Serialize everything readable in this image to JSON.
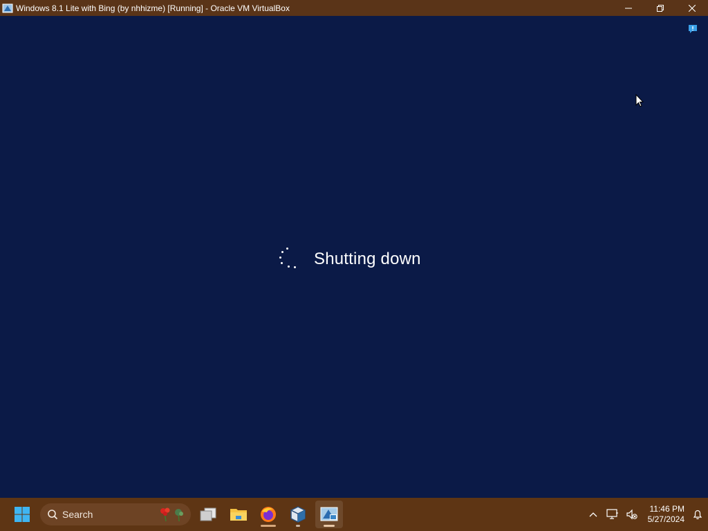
{
  "window": {
    "title": "Windows 8.1 Lite with Bing (by nhhizme) [Running] - Oracle VM VirtualBox",
    "minimize_label": "Minimize",
    "maximize_label": "Restore",
    "close_label": "Close",
    "titlebar_color": "#5a3418"
  },
  "vm": {
    "background_color": "#0b1a47",
    "status_text": "Shutting down",
    "spinner_icon": "loading-spinner-icon",
    "notify_icon": "action-center-notification-icon"
  },
  "taskbar": {
    "background_color": "#5e3514",
    "start_icon": "windows-start-icon",
    "search": {
      "placeholder": "Search",
      "icon": "search-icon",
      "highlight_icon": "search-highlight-flowers-icon"
    },
    "apps": [
      {
        "name": "task-view",
        "icon": "task-view-icon",
        "running": false
      },
      {
        "name": "file-explorer",
        "icon": "folder-icon",
        "running": false
      },
      {
        "name": "firefox",
        "icon": "firefox-icon",
        "running": true
      },
      {
        "name": "virtualbox-manager",
        "icon": "virtualbox-cube-icon",
        "running": true
      },
      {
        "name": "virtualbox-vm",
        "icon": "virtualbox-vm-window-icon",
        "running": true,
        "active": true
      }
    ],
    "tray": {
      "overflow_icon": "chevron-up-icon",
      "network_icon": "network-icon",
      "volume_icon": "volume-muted-icon",
      "time": "11:46 PM",
      "date": "5/27/2024",
      "notifications_icon": "bell-icon"
    }
  }
}
